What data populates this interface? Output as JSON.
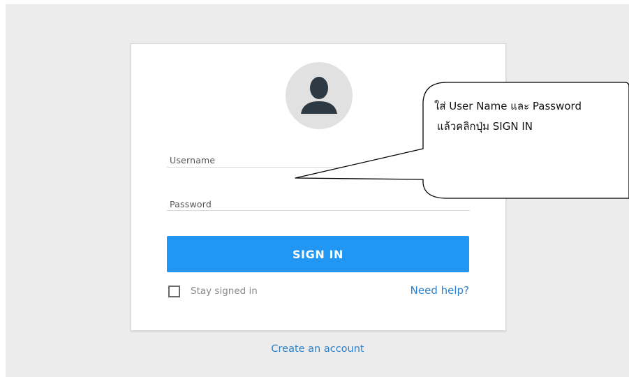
{
  "login": {
    "username_label": "Username",
    "password_label": "Password",
    "signin_label": "SIGN IN",
    "stay_signed_in_label": "Stay signed in",
    "need_help_label": "Need help?",
    "create_account_label": "Create an account"
  },
  "callout": {
    "line1": "ใส่ User Name และ Password",
    "line2": "แล้วคลิกปุ่ม SIGN IN"
  },
  "colors": {
    "accent": "#2196f3",
    "link": "#2d7fc8",
    "background": "#ececec"
  }
}
